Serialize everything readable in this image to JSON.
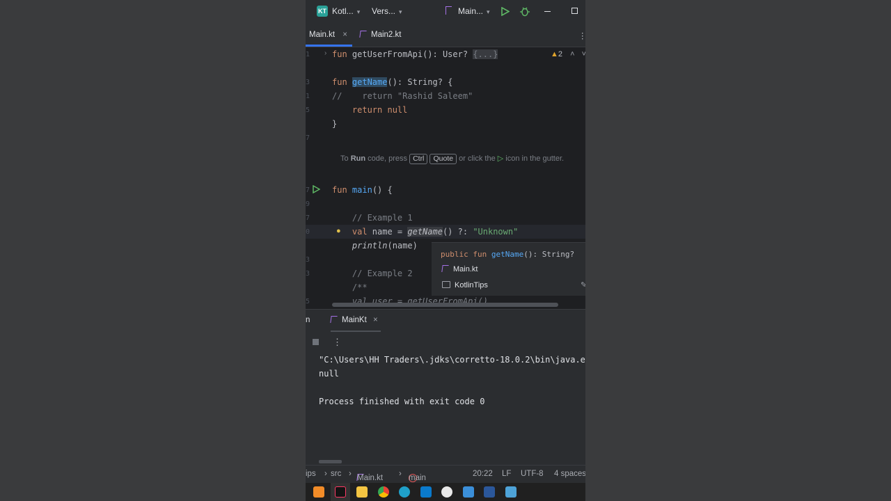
{
  "titlebar": {
    "project_badge": "KT",
    "project": "Kotl...",
    "vcs": "Vers...",
    "run_config": "Main...",
    "colors": {
      "badge": "#2aa198",
      "run": "#5fb865",
      "debug": "#5fb865"
    }
  },
  "tabs": [
    {
      "label": "Main.kt",
      "active": true
    },
    {
      "label": "Main2.kt",
      "active": false
    }
  ],
  "editor": {
    "warnings_count": "2",
    "gutter_numbers": [
      "1",
      "",
      "3",
      "",
      "5",
      "",
      "",
      "",
      "7",
      "",
      "9",
      "",
      "0",
      "",
      "1",
      "",
      "3",
      "",
      ""
    ],
    "hint": {
      "pre": "To ",
      "bold": "Run",
      "mid": " code, press ",
      "key1": "Ctrl",
      "key2": "Quote",
      "post": " or click the",
      "post2": " icon in the gutter."
    },
    "lines": {
      "l1_kw": "fun ",
      "l1_fn": "getUserFromApi",
      "l1_rest": "(): User?",
      "l1_fold": "{...}",
      "l2_kw": "fun ",
      "l2_fn": "getName",
      "l2_rest": "(): String? {",
      "l3_cm": "//    return \"Rashid Saleem\"",
      "l4_kw": "    return null",
      "l5": "}",
      "l6_kw": "fun ",
      "l6_fn": "main",
      "l6_rest": "() {",
      "l7_cm": "    // Example 1",
      "l8_kw": "    val ",
      "l8_rest": "name = ",
      "l8_call": "getName",
      "l8_mid": "() ?: ",
      "l8_str": "\"Unknown\"",
      "l9_call": "    println",
      "l9_rest": "(name)",
      "l10_cm": "    // Example 2",
      "l11_cm": "    /**",
      "l12_cm": "    val user = getUserFromApi()"
    },
    "popup": {
      "sig_kw": "public fun ",
      "sig_fn": "getName",
      "sig_rest": "(): String?",
      "file": "Main.kt",
      "module": "KotlinTips"
    }
  },
  "run_panel": {
    "left_label": "n",
    "tab": "MainKt",
    "lines": [
      "\"C:\\Users\\HH Traders\\.jdks\\corretto-18.0.2\\bin\\java.e",
      "null",
      "",
      "Process finished with exit code 0"
    ]
  },
  "statusbar": {
    "crumb1": "ips",
    "crumb2": "src",
    "crumb3": "Main.kt",
    "crumb4": "main",
    "position": "20:22",
    "line_sep": "LF",
    "encoding": "UTF-8",
    "indent": "4 spaces"
  },
  "taskbar": {
    "apps": [
      "sublime-icon",
      "intellij-icon",
      "explorer-icon",
      "chrome-icon",
      "edge-icon",
      "vscode-icon",
      "spotify-icon",
      "photos-icon",
      "word-icon",
      "notepad-icon"
    ]
  }
}
